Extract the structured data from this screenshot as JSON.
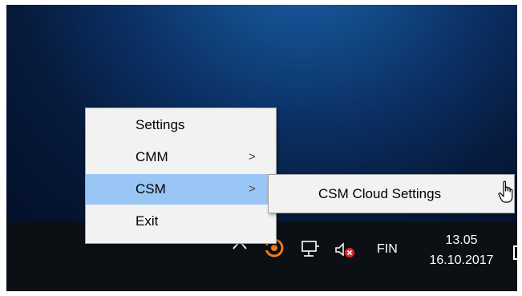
{
  "context_menu": {
    "items": [
      {
        "label": "Settings",
        "has_submenu": false,
        "active": false
      },
      {
        "label": "CMM",
        "has_submenu": true,
        "active": false,
        "arrow": ">"
      },
      {
        "label": "CSM",
        "has_submenu": true,
        "active": true,
        "arrow": ">"
      },
      {
        "label": "Exit",
        "has_submenu": false,
        "active": false
      }
    ]
  },
  "submenu": {
    "items": [
      {
        "label": "CSM Cloud Settings"
      }
    ]
  },
  "tray": {
    "language": "FIN",
    "time": "13.05",
    "date": "16.10.2017",
    "icons": [
      "chevron-up-icon",
      "csm-app-icon",
      "network-icon",
      "volume-muted-icon",
      "notification-icon"
    ]
  },
  "colors": {
    "menu_background": "#f2f2f2",
    "menu_highlight": "#99c6f5",
    "taskbar": "#0c0f14",
    "desktop_accent": "#124986"
  }
}
